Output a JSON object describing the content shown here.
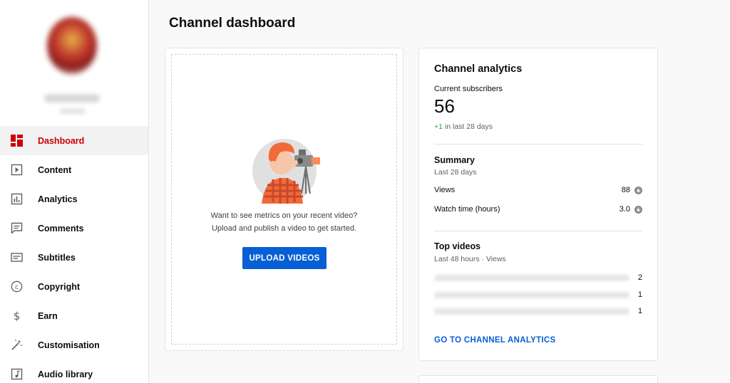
{
  "sidebar": {
    "items": [
      {
        "label": "Dashboard",
        "icon": "dashboard-icon",
        "active": true
      },
      {
        "label": "Content",
        "icon": "content-icon"
      },
      {
        "label": "Analytics",
        "icon": "analytics-icon"
      },
      {
        "label": "Comments",
        "icon": "comments-icon"
      },
      {
        "label": "Subtitles",
        "icon": "subtitles-icon"
      },
      {
        "label": "Copyright",
        "icon": "copyright-icon"
      },
      {
        "label": "Earn",
        "icon": "dollar-icon"
      },
      {
        "label": "Customisation",
        "icon": "magic-wand-icon"
      },
      {
        "label": "Audio library",
        "icon": "audio-library-icon"
      }
    ]
  },
  "main": {
    "title": "Channel dashboard"
  },
  "upload_card": {
    "line1": "Want to see metrics on your recent video?",
    "line2": "Upload and publish a video to get started.",
    "button": "UPLOAD VIDEOS"
  },
  "analytics": {
    "title": "Channel analytics",
    "subscribers_label": "Current subscribers",
    "subscribers": "56",
    "delta": "+1",
    "delta_suffix": " in last 28 days",
    "summary_title": "Summary",
    "summary_period": "Last 28 days",
    "metrics": [
      {
        "label": "Views",
        "value": "88"
      },
      {
        "label": "Watch time (hours)",
        "value": "3.0"
      }
    ],
    "top_title": "Top videos",
    "top_period": "Last 48 hours · Views",
    "top_videos": [
      {
        "views": "2"
      },
      {
        "views": "1"
      },
      {
        "views": "1"
      }
    ],
    "link": "GO TO CHANNEL ANALYTICS"
  },
  "colors": {
    "accent_red": "#cc0000",
    "link_blue": "#065fd4",
    "positive_green": "#2ba640"
  }
}
